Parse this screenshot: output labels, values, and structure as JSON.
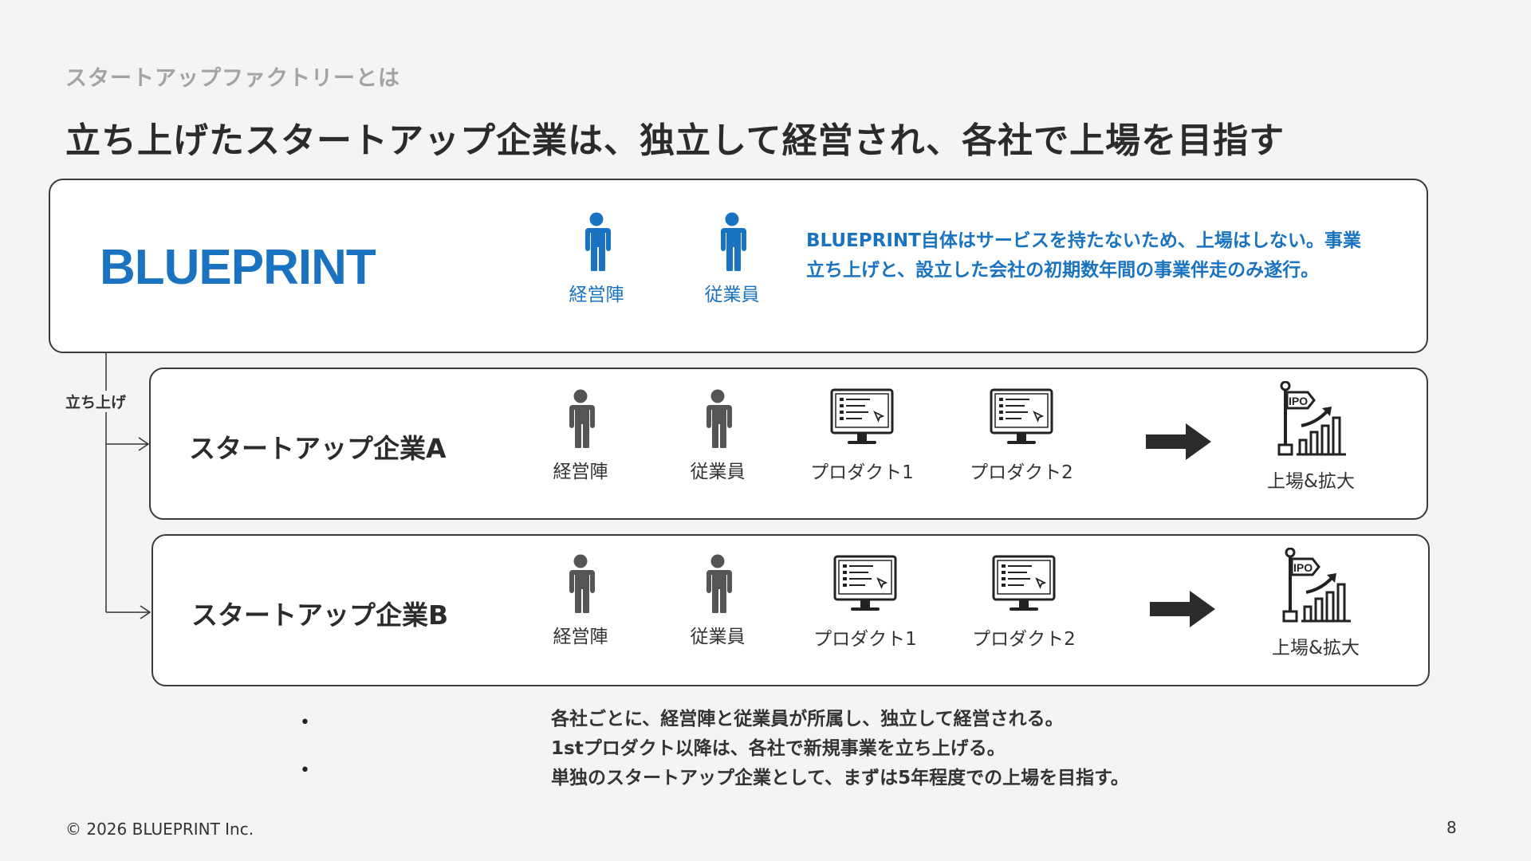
{
  "header": {
    "subtitle": "スタートアップファクトリーとは",
    "headline": "立ち上げたスタートアップ企業は、独立して経営され、各社で上場を目指す"
  },
  "blueprint": {
    "logo": "BLUEPRINT",
    "roles": [
      "経営陣",
      "従業員"
    ],
    "description": "BLUEPRINT自体はサービスを持たないため、上場はしない。事業立ち上げと、設立した会社の初期数年間の事業伴走のみ遂行。"
  },
  "launch_label": "立ち上げ",
  "companies": [
    {
      "name": "スタートアップ企業A",
      "roles": [
        "経営陣",
        "従業員"
      ],
      "products": [
        "プロダクト1",
        "プロダクト2"
      ],
      "goal": "上場&拡大",
      "goal_badge": "IPO"
    },
    {
      "name": "スタートアップ企業B",
      "roles": [
        "経営陣",
        "従業員"
      ],
      "products": [
        "プロダクト1",
        "プロダクト2"
      ],
      "goal": "上場&拡大",
      "goal_badge": "IPO"
    }
  ],
  "notes": {
    "bullets": [
      "•",
      "•"
    ],
    "lines": [
      "各社ごとに、経営陣と従業員が所属し、独立して経営される。",
      "1stプロダクト以降は、各社で新規事業を立ち上げる。",
      "単独のスタートアップ企業として、まずは5年程度での上場を目指す。"
    ]
  },
  "footer": {
    "copyright": "© 2026 BLUEPRINT Inc.",
    "page_number": "8"
  },
  "colors": {
    "brand_blue": "#1a73c0",
    "icon_dark": "#555555",
    "text_dark": "#2b2b2b"
  },
  "icons": {
    "person": "person-icon",
    "product": "monitor-icon",
    "arrow": "arrow-right-icon",
    "goal": "ipo-growth-icon"
  }
}
